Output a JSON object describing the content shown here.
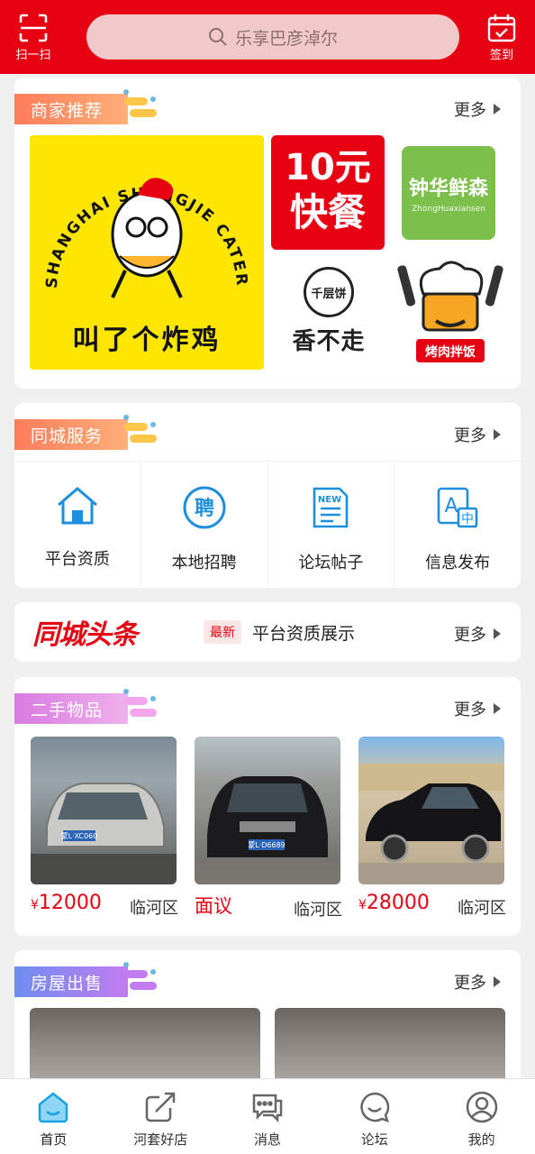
{
  "header": {
    "scan_label": "扫一扫",
    "search_placeholder": "乐享巴彦淖尔",
    "checkin_label": "签到",
    "brand_color": "#e60012"
  },
  "merchants": {
    "title": "商家推荐",
    "more": "更多",
    "items": [
      {
        "name": "叫了个炸鸡",
        "logo_text": "SHANGHAI SHANGJIE CATERING"
      },
      {
        "name_line1": "10元",
        "name_line2": "快餐"
      },
      {
        "name": "钟华鲜森",
        "sub": "ZhongHuaxiansen"
      },
      {
        "name": "香不走",
        "badge": "千层饼"
      },
      {
        "name": "烤肉拌饭"
      }
    ]
  },
  "services": {
    "title": "同城服务",
    "more": "更多",
    "items": [
      {
        "label": "平台资质",
        "icon": "home-icon"
      },
      {
        "label": "本地招聘",
        "icon": "recruit-icon"
      },
      {
        "label": "论坛帖子",
        "icon": "news-doc-icon"
      },
      {
        "label": "信息发布",
        "icon": "publish-icon"
      }
    ]
  },
  "headline": {
    "logo": "同城头条",
    "badge": "最新",
    "text": "平台资质展示",
    "more": "更多"
  },
  "secondhand": {
    "title": "二手物品",
    "more": "更多",
    "items": [
      {
        "currency": "¥",
        "price": "12000",
        "area": "临河区",
        "plate": "蒙L·XC060",
        "color": "silver"
      },
      {
        "currency": "",
        "price": "面议",
        "area": "临河区",
        "plate": "蒙L·D6689",
        "color": "black"
      },
      {
        "currency": "¥",
        "price": "28000",
        "area": "临河区",
        "plate": "",
        "color": "black"
      }
    ]
  },
  "houses": {
    "title": "房屋出售",
    "more": "更多"
  },
  "tabbar": {
    "items": [
      {
        "label": "首页",
        "icon": "home-tab-icon",
        "active": true
      },
      {
        "label": "河套好店",
        "icon": "share-arrow-icon",
        "active": false
      },
      {
        "label": "消息",
        "icon": "message-icon",
        "active": false
      },
      {
        "label": "论坛",
        "icon": "smile-chat-icon",
        "active": false
      },
      {
        "label": "我的",
        "icon": "user-icon",
        "active": false
      }
    ],
    "active_color": "#19a0e0"
  }
}
